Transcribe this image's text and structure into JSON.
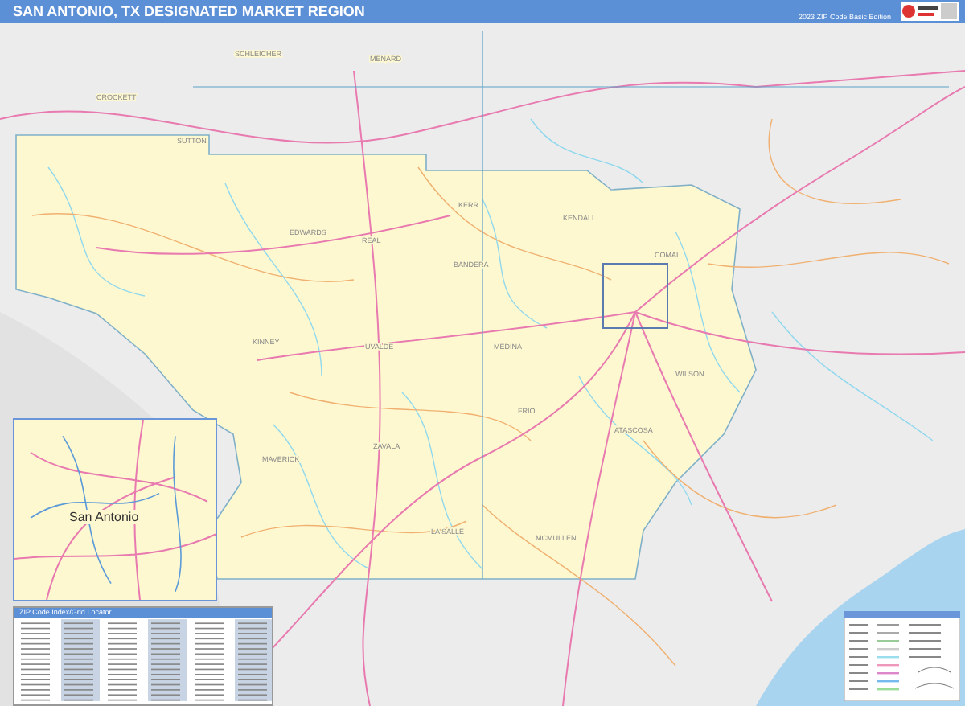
{
  "header": {
    "title": "SAN ANTONIO, TX DESIGNATED MARKET REGION",
    "edition": "2023 ZIP Code Basic Edition"
  },
  "counties": [
    "SCHLEICHER",
    "MENARD",
    "CROCKETT",
    "SUTTON",
    "EDWARDS",
    "REAL",
    "KERR",
    "BANDERA",
    "KENDALL",
    "COMAL",
    "KINNEY",
    "UVALDE",
    "MEDINA",
    "ZAVALA",
    "MAVERICK",
    "FRIO",
    "ATASCOSA",
    "WILSON",
    "LA SALLE",
    "MCMULLEN"
  ],
  "inset": {
    "city_label": "San Antonio"
  },
  "index": {
    "title": "ZIP Code Index/Grid Locator"
  }
}
